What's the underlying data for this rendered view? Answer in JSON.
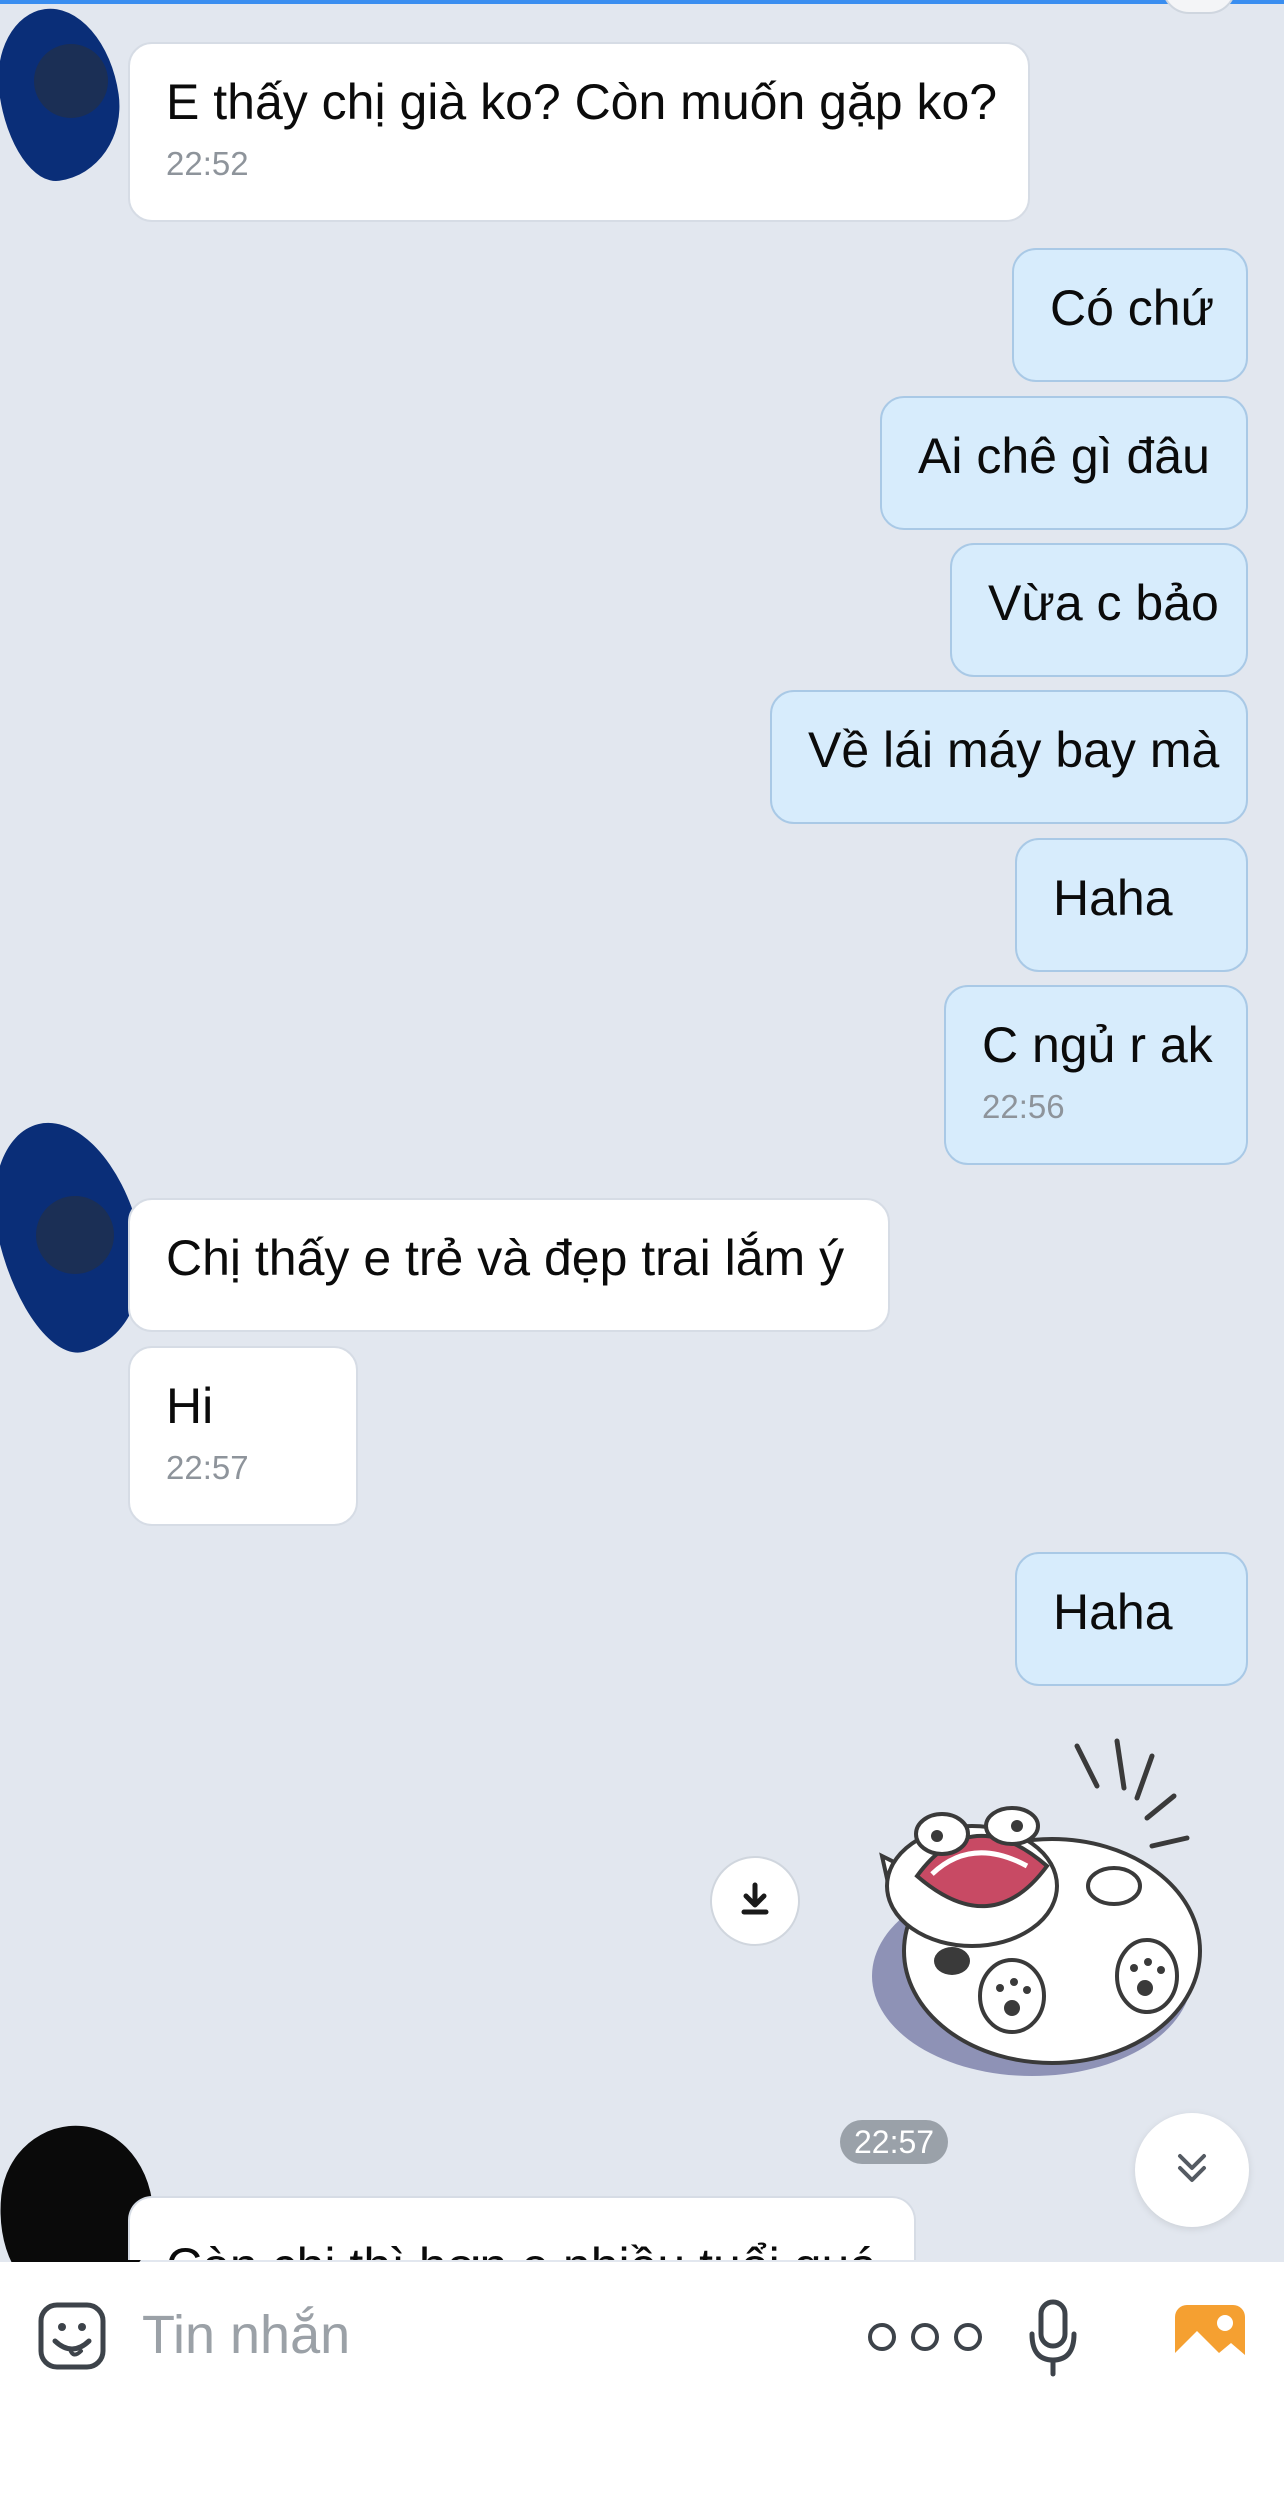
{
  "conversation": {
    "messages": [
      {
        "sender": "contact",
        "text": "E thấy chị già ko? Còn muốn gặp ko?",
        "time": "22:52"
      },
      {
        "sender": "me",
        "text": "Có chứ"
      },
      {
        "sender": "me",
        "text": "Ai chê gì đâu"
      },
      {
        "sender": "me",
        "text": "Vừa c bảo"
      },
      {
        "sender": "me",
        "text": "Về lái máy bay mà"
      },
      {
        "sender": "me",
        "text": "Haha"
      },
      {
        "sender": "me",
        "text": "C ngủ r ak",
        "time": "22:56"
      },
      {
        "sender": "contact",
        "text": "Chị thấy e trẻ và đẹp trai lắm ý"
      },
      {
        "sender": "contact",
        "text": "Hi",
        "time": "22:57"
      },
      {
        "sender": "me",
        "text": "Haha"
      },
      {
        "sender": "me",
        "type": "sticker",
        "sticker": "cat-laughing-rolling",
        "time": "22:57"
      },
      {
        "sender": "contact",
        "text": "Còn chị thì hơn e nhiều tuổi quá"
      }
    ]
  },
  "composer": {
    "placeholder": "Tin nhắn",
    "icons": [
      "emoji-icon",
      "more-options-icon",
      "microphone-icon",
      "image-gallery-icon"
    ]
  },
  "colors": {
    "background": "#e2e7ef",
    "incoming_bubble": "#ffffff",
    "outgoing_bubble": "#d7ecfc",
    "accent": "#3a8ef0",
    "gallery_icon": "#f5a031"
  }
}
